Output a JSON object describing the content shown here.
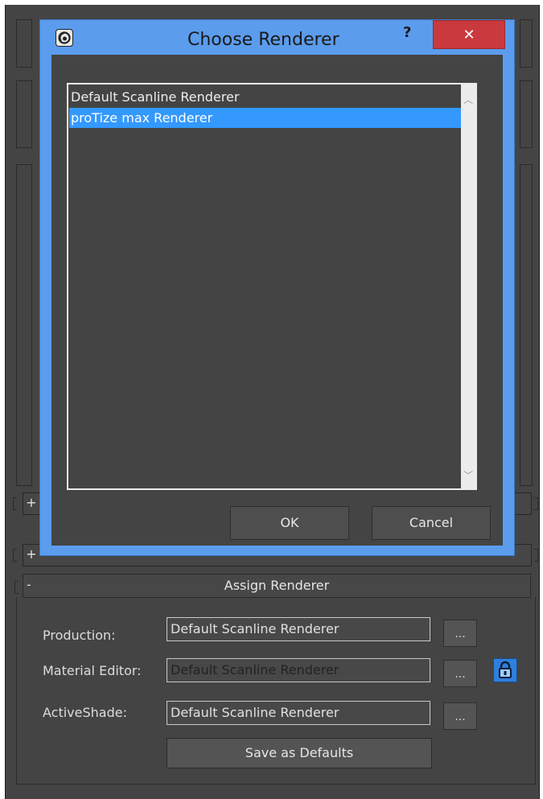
{
  "dialog": {
    "title": "Choose Renderer",
    "help_label": "?",
    "close_label": "✕",
    "renderers": [
      {
        "label": "Default Scanline Renderer",
        "selected": false
      },
      {
        "label": "proTize max Renderer",
        "selected": true
      }
    ],
    "ok_label": "OK",
    "cancel_label": "Cancel",
    "selection_color": "#3399ff",
    "frame_color": "#5b9ced"
  },
  "rollouts": {
    "collapsed_a": "+",
    "collapsed_b": "+"
  },
  "assign_renderer": {
    "toggle": "-",
    "title": "Assign Renderer",
    "production": {
      "label": "Production:",
      "value": "Default Scanline Renderer"
    },
    "material_editor": {
      "label": "Material Editor:",
      "value": "Default Scanline Renderer"
    },
    "activeshade": {
      "label": "ActiveShade:",
      "value": "Default Scanline Renderer"
    },
    "browse_label": "...",
    "save_defaults_label": "Save as Defaults",
    "lock_icon": "lock-icon",
    "lock_active": true
  }
}
